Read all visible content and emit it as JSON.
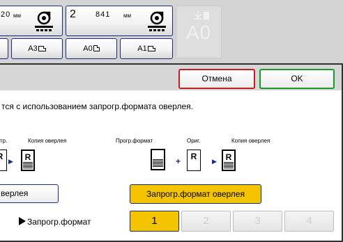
{
  "trays": [
    {
      "number": "",
      "length": "20",
      "unit": "мм"
    },
    {
      "number": "2",
      "length": "841",
      "unit": "мм"
    }
  ],
  "size_buttons": [
    {
      "label": ""
    },
    {
      "label": "A3"
    },
    {
      "label": "A0"
    },
    {
      "label": "A1"
    }
  ],
  "a0_button": {
    "label": "A0"
  },
  "dialog": {
    "cancel_label": "Отмена",
    "ok_label": "OK",
    "message": "тся с использованием запрогр.формата оверлея.",
    "left_diagram": {
      "label_orig": "тр.",
      "label_copy": "Копия оверлея"
    },
    "right_diagram": {
      "label_format": "Прогр.формат",
      "label_orig": "Ориг.",
      "label_copy": "Копия оверлея"
    },
    "page_letter": "R",
    "plus": "+",
    "arrow": "▶",
    "overlay_left_label": "верлея",
    "overlay_right_label": "Запрогр.формат оверлея",
    "format_label": "Запрогр.формат",
    "numbers": [
      "1",
      "2",
      "3",
      "4"
    ]
  },
  "colors": {
    "accent_yellow": "#f5c400",
    "cancel_red": "#c02020",
    "ok_green": "#1a9a28",
    "border_navy": "#1a2a80"
  }
}
